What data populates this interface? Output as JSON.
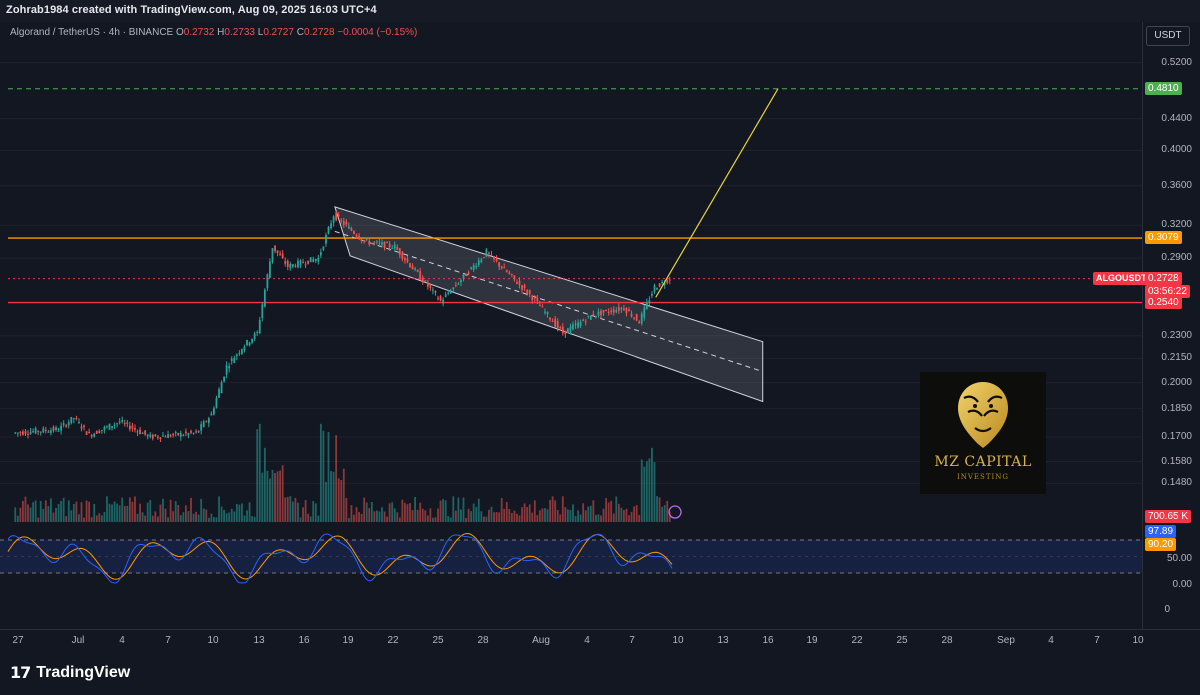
{
  "header": {
    "credit": "Zohrab1984 created with TradingView.com, Aug 09, 2025 16:03 UTC+4"
  },
  "legend": {
    "symbol": "Algorand / TetherUS · 4h · BINANCE",
    "o_label": "O",
    "o_value": "0.2732",
    "h_label": "H",
    "h_value": "0.2733",
    "l_label": "L",
    "l_value": "0.2727",
    "c_label": "C",
    "c_value": "0.2728",
    "change": "−0.0004 (−0.15%)"
  },
  "price_scale": {
    "currency": "USDT",
    "ticks": [
      {
        "label": "0.5200",
        "value": 0.52
      },
      {
        "label": "0.4400",
        "value": 0.44
      },
      {
        "label": "0.4000",
        "value": 0.4
      },
      {
        "label": "0.3600",
        "value": 0.36
      },
      {
        "label": "0.3200",
        "value": 0.32
      },
      {
        "label": "0.2900",
        "value": 0.29
      },
      {
        "label": "0.2300",
        "value": 0.23
      },
      {
        "label": "0.2150",
        "value": 0.215
      },
      {
        "label": "0.2000",
        "value": 0.2
      },
      {
        "label": "0.1850",
        "value": 0.185
      },
      {
        "label": "0.1700",
        "value": 0.17
      },
      {
        "label": "0.1580",
        "value": 0.158
      },
      {
        "label": "0.1480",
        "value": 0.148
      }
    ],
    "oscillator_ticks": [
      "50.00",
      "0.00",
      "0"
    ],
    "tags": {
      "target": "0.4810",
      "resistance": "0.3079",
      "symbol": "ALGOUSDT",
      "last": "0.2728",
      "countdown": "03:56:22",
      "support": "0.2540",
      "volume": "700.65 K",
      "stoch_k": "97.89",
      "stoch_d": "90.20"
    },
    "colors": {
      "target": "#4caf50",
      "resistance": "#ff9800",
      "last": "#f23645",
      "support": "#f23645",
      "volume": "#f23645",
      "stoch_k": "#2962ff",
      "stoch_d": "#ff9800"
    }
  },
  "time_axis": [
    "27",
    "Jul",
    "4",
    "7",
    "10",
    "13",
    "16",
    "19",
    "22",
    "25",
    "28",
    "Aug",
    "4",
    "7",
    "10",
    "13",
    "16",
    "19",
    "22",
    "25",
    "28",
    "Sep",
    "4",
    "7",
    "10"
  ],
  "watermark": {
    "title": "MZ CAPITAL",
    "subtitle": "INVESTING"
  },
  "footer": {
    "logo_mark": "17",
    "logo_name": "TradingView"
  },
  "chart_data": {
    "type": "candlestick",
    "title": "",
    "symbol": "ALGOUSDT",
    "interval": "4h",
    "exchange": "BINANCE",
    "scale": "log",
    "ylim": [
      0.14,
      0.54
    ],
    "x_range": [
      "2025-06-26",
      "2025-09-10"
    ],
    "close_path": [
      {
        "date": "2025-06-27",
        "close": 0.172
      },
      {
        "date": "2025-06-30",
        "close": 0.174
      },
      {
        "date": "2025-07-01",
        "close": 0.18
      },
      {
        "date": "2025-07-02",
        "close": 0.171
      },
      {
        "date": "2025-07-04",
        "close": 0.178
      },
      {
        "date": "2025-07-06",
        "close": 0.17
      },
      {
        "date": "2025-07-09",
        "close": 0.172
      },
      {
        "date": "2025-07-10",
        "close": 0.182
      },
      {
        "date": "2025-07-11",
        "close": 0.21
      },
      {
        "date": "2025-07-12",
        "close": 0.222
      },
      {
        "date": "2025-07-13",
        "close": 0.232
      },
      {
        "date": "2025-07-14",
        "close": 0.3
      },
      {
        "date": "2025-07-15",
        "close": 0.283
      },
      {
        "date": "2025-07-17",
        "close": 0.29
      },
      {
        "date": "2025-07-18",
        "close": 0.33
      },
      {
        "date": "2025-07-20",
        "close": 0.305
      },
      {
        "date": "2025-07-22",
        "close": 0.3
      },
      {
        "date": "2025-07-25",
        "close": 0.255
      },
      {
        "date": "2025-07-28",
        "close": 0.295
      },
      {
        "date": "2025-07-31",
        "close": 0.258
      },
      {
        "date": "2025-08-02",
        "close": 0.232
      },
      {
        "date": "2025-08-04",
        "close": 0.245
      },
      {
        "date": "2025-08-06",
        "close": 0.25
      },
      {
        "date": "2025-08-07",
        "close": 0.24
      },
      {
        "date": "2025-08-08",
        "close": 0.266
      },
      {
        "date": "2025-08-09",
        "close": 0.2728
      }
    ],
    "horizontal_lines": [
      {
        "value": 0.481,
        "style": "dashed",
        "color": "#4caf50"
      },
      {
        "value": 0.3079,
        "style": "solid",
        "color": "#ff9800"
      },
      {
        "value": 0.2728,
        "style": "dotted",
        "color": "#f23645"
      },
      {
        "value": 0.254,
        "style": "solid",
        "color": "#f23645"
      }
    ],
    "channel": {
      "upper": [
        {
          "date": "2025-07-18",
          "value": 0.338
        },
        {
          "date": "2025-08-15",
          "value": 0.226
        }
      ],
      "lower": [
        {
          "date": "2025-07-19",
          "value": 0.292
        },
        {
          "date": "2025-08-15",
          "value": 0.189
        }
      ]
    },
    "projection": [
      {
        "date": "2025-08-08",
        "value": 0.258
      },
      {
        "date": "2025-08-16",
        "value": 0.481
      }
    ],
    "volume_last": "700.65 K",
    "oscillator": {
      "type": "stochastic_rsi",
      "k": 97.89,
      "d": 90.2,
      "bands": [
        80,
        20
      ]
    }
  }
}
